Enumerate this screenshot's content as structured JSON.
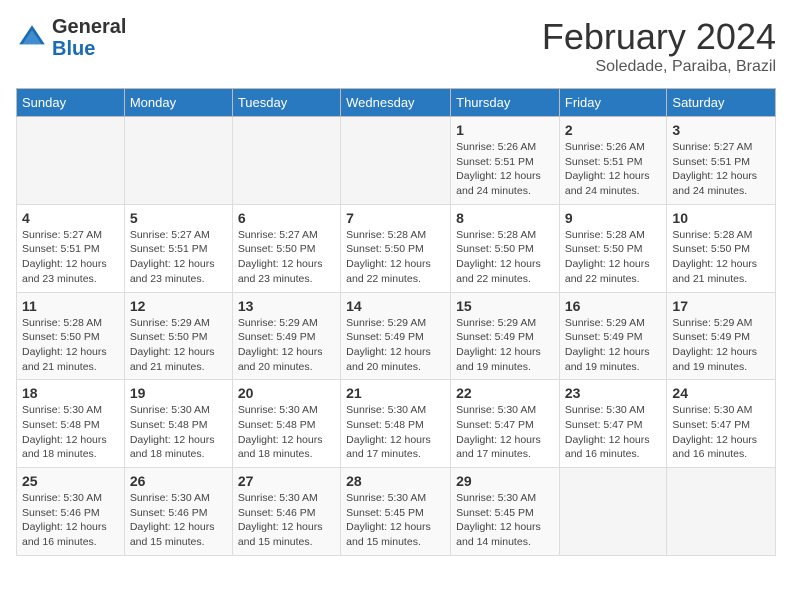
{
  "header": {
    "logo_general": "General",
    "logo_blue": "Blue",
    "month_title": "February 2024",
    "location": "Soledade, Paraiba, Brazil"
  },
  "calendar": {
    "days_of_week": [
      "Sunday",
      "Monday",
      "Tuesday",
      "Wednesday",
      "Thursday",
      "Friday",
      "Saturday"
    ],
    "weeks": [
      [
        {
          "day": "",
          "info": ""
        },
        {
          "day": "",
          "info": ""
        },
        {
          "day": "",
          "info": ""
        },
        {
          "day": "",
          "info": ""
        },
        {
          "day": "1",
          "info": "Sunrise: 5:26 AM\nSunset: 5:51 PM\nDaylight: 12 hours\nand 24 minutes."
        },
        {
          "day": "2",
          "info": "Sunrise: 5:26 AM\nSunset: 5:51 PM\nDaylight: 12 hours\nand 24 minutes."
        },
        {
          "day": "3",
          "info": "Sunrise: 5:27 AM\nSunset: 5:51 PM\nDaylight: 12 hours\nand 24 minutes."
        }
      ],
      [
        {
          "day": "4",
          "info": "Sunrise: 5:27 AM\nSunset: 5:51 PM\nDaylight: 12 hours\nand 23 minutes."
        },
        {
          "day": "5",
          "info": "Sunrise: 5:27 AM\nSunset: 5:51 PM\nDaylight: 12 hours\nand 23 minutes."
        },
        {
          "day": "6",
          "info": "Sunrise: 5:27 AM\nSunset: 5:50 PM\nDaylight: 12 hours\nand 23 minutes."
        },
        {
          "day": "7",
          "info": "Sunrise: 5:28 AM\nSunset: 5:50 PM\nDaylight: 12 hours\nand 22 minutes."
        },
        {
          "day": "8",
          "info": "Sunrise: 5:28 AM\nSunset: 5:50 PM\nDaylight: 12 hours\nand 22 minutes."
        },
        {
          "day": "9",
          "info": "Sunrise: 5:28 AM\nSunset: 5:50 PM\nDaylight: 12 hours\nand 22 minutes."
        },
        {
          "day": "10",
          "info": "Sunrise: 5:28 AM\nSunset: 5:50 PM\nDaylight: 12 hours\nand 21 minutes."
        }
      ],
      [
        {
          "day": "11",
          "info": "Sunrise: 5:28 AM\nSunset: 5:50 PM\nDaylight: 12 hours\nand 21 minutes."
        },
        {
          "day": "12",
          "info": "Sunrise: 5:29 AM\nSunset: 5:50 PM\nDaylight: 12 hours\nand 21 minutes."
        },
        {
          "day": "13",
          "info": "Sunrise: 5:29 AM\nSunset: 5:49 PM\nDaylight: 12 hours\nand 20 minutes."
        },
        {
          "day": "14",
          "info": "Sunrise: 5:29 AM\nSunset: 5:49 PM\nDaylight: 12 hours\nand 20 minutes."
        },
        {
          "day": "15",
          "info": "Sunrise: 5:29 AM\nSunset: 5:49 PM\nDaylight: 12 hours\nand 19 minutes."
        },
        {
          "day": "16",
          "info": "Sunrise: 5:29 AM\nSunset: 5:49 PM\nDaylight: 12 hours\nand 19 minutes."
        },
        {
          "day": "17",
          "info": "Sunrise: 5:29 AM\nSunset: 5:49 PM\nDaylight: 12 hours\nand 19 minutes."
        }
      ],
      [
        {
          "day": "18",
          "info": "Sunrise: 5:30 AM\nSunset: 5:48 PM\nDaylight: 12 hours\nand 18 minutes."
        },
        {
          "day": "19",
          "info": "Sunrise: 5:30 AM\nSunset: 5:48 PM\nDaylight: 12 hours\nand 18 minutes."
        },
        {
          "day": "20",
          "info": "Sunrise: 5:30 AM\nSunset: 5:48 PM\nDaylight: 12 hours\nand 18 minutes."
        },
        {
          "day": "21",
          "info": "Sunrise: 5:30 AM\nSunset: 5:48 PM\nDaylight: 12 hours\nand 17 minutes."
        },
        {
          "day": "22",
          "info": "Sunrise: 5:30 AM\nSunset: 5:47 PM\nDaylight: 12 hours\nand 17 minutes."
        },
        {
          "day": "23",
          "info": "Sunrise: 5:30 AM\nSunset: 5:47 PM\nDaylight: 12 hours\nand 16 minutes."
        },
        {
          "day": "24",
          "info": "Sunrise: 5:30 AM\nSunset: 5:47 PM\nDaylight: 12 hours\nand 16 minutes."
        }
      ],
      [
        {
          "day": "25",
          "info": "Sunrise: 5:30 AM\nSunset: 5:46 PM\nDaylight: 12 hours\nand 16 minutes."
        },
        {
          "day": "26",
          "info": "Sunrise: 5:30 AM\nSunset: 5:46 PM\nDaylight: 12 hours\nand 15 minutes."
        },
        {
          "day": "27",
          "info": "Sunrise: 5:30 AM\nSunset: 5:46 PM\nDaylight: 12 hours\nand 15 minutes."
        },
        {
          "day": "28",
          "info": "Sunrise: 5:30 AM\nSunset: 5:45 PM\nDaylight: 12 hours\nand 15 minutes."
        },
        {
          "day": "29",
          "info": "Sunrise: 5:30 AM\nSunset: 5:45 PM\nDaylight: 12 hours\nand 14 minutes."
        },
        {
          "day": "",
          "info": ""
        },
        {
          "day": "",
          "info": ""
        }
      ]
    ]
  }
}
